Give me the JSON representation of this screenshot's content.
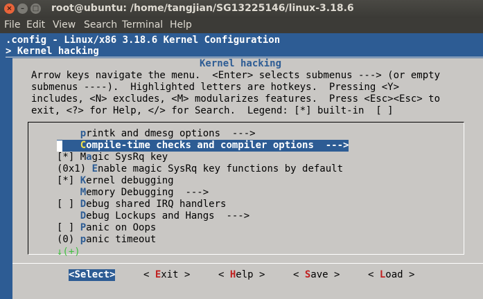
{
  "window": {
    "title": "root@ubuntu: /home/tangjian/SG13225146/linux-3.18.6",
    "close_glyph": "×",
    "min_glyph": "–",
    "max_glyph": "□"
  },
  "menubar": [
    "File",
    "Edit",
    "View",
    "Search",
    "Terminal",
    "Help"
  ],
  "terminal": {
    "config_line": ".config - Linux/x86 3.18.6 Kernel Configuration",
    "breadcrumb": "> Kernel hacking"
  },
  "dialog": {
    "title": "Kernel hacking",
    "help_lines": [
      "Arrow keys navigate the menu.  <Enter> selects submenus ---> (or empty",
      "submenus ----).  Highlighted letters are hotkeys.  Pressing <Y>",
      "includes, <N> excludes, <M> modularizes features.  Press <Esc><Esc> to",
      "exit, <?> for Help, </> for Search.  Legend: [*] built-in  [ ]"
    ],
    "items": [
      {
        "prefix": "    ",
        "hot": "p",
        "rest": "rintk and dmesg options  --->"
      },
      {
        "prefix": "    ",
        "hot": "C",
        "rest": "ompile-time checks and compiler options  --->"
      },
      {
        "prefix": "[*] M",
        "hot": "a",
        "rest": "gic SysRq key"
      },
      {
        "prefix": "(0x1) ",
        "hot": "E",
        "rest": "nable magic SysRq key functions by default"
      },
      {
        "prefix": "[*] ",
        "hot": "K",
        "rest": "ernel debugging"
      },
      {
        "prefix": "    ",
        "hot": "M",
        "rest": "emory Debugging  --->"
      },
      {
        "prefix": "[ ] ",
        "hot": "D",
        "rest": "ebug shared IRQ handlers"
      },
      {
        "prefix": "    ",
        "hot": "D",
        "rest": "ebug Lockups and Hangs  --->"
      },
      {
        "prefix": "[ ] ",
        "hot": "P",
        "rest": "anic on Oops"
      },
      {
        "prefix": "(0) ",
        "hot": "p",
        "rest": "anic timeout"
      }
    ],
    "more_indicator": "↓(+)",
    "buttons": [
      {
        "open": "<",
        "hot": "S",
        "rest": "elect",
        "close": ">"
      },
      {
        "open": "< ",
        "hot": "E",
        "rest": "xit",
        "close": " >"
      },
      {
        "open": "< ",
        "hot": "H",
        "rest": "elp",
        "close": " >"
      },
      {
        "open": "< ",
        "hot": "S",
        "rest": "ave",
        "close": " >"
      },
      {
        "open": "< ",
        "hot": "L",
        "rest": "oad",
        "close": " >"
      }
    ]
  }
}
